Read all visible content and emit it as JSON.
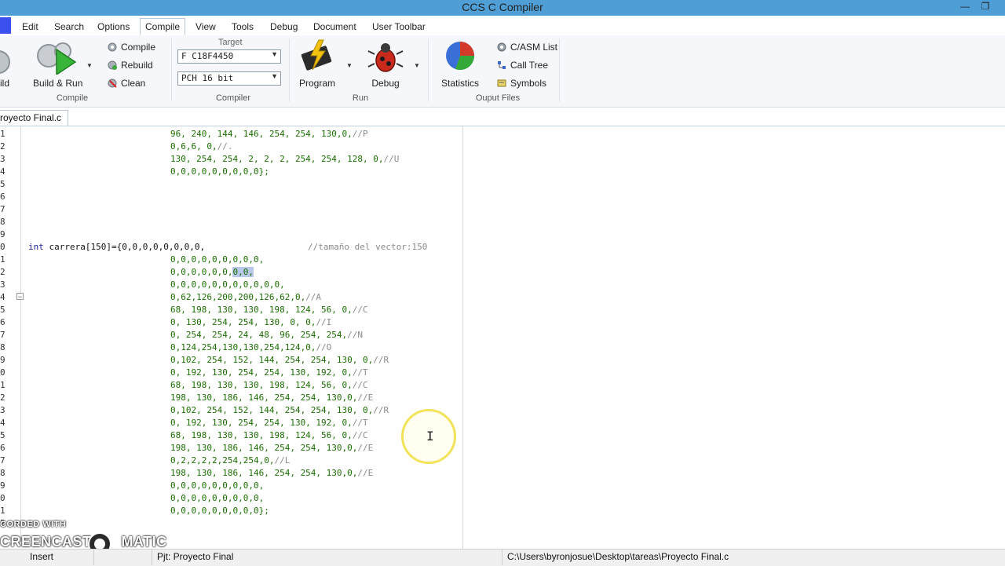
{
  "window": {
    "title": "CCS C Compiler"
  },
  "menu": {
    "items": [
      "Edit",
      "Search",
      "Options",
      "Compile",
      "View",
      "Tools",
      "Debug",
      "Document",
      "User Toolbar"
    ],
    "active": "Compile"
  },
  "ribbon": {
    "compile_group": {
      "label": "Compile",
      "build_partial": "ild",
      "build_run": "Build & Run",
      "compile": "Compile",
      "rebuild": "Rebuild",
      "clean": "Clean"
    },
    "compiler_group": {
      "label": "Compiler",
      "target_label": "Target",
      "target_value": "F C18F4450",
      "compiler_value": "PCH 16 bit"
    },
    "run_group": {
      "label": "Run",
      "program": "Program",
      "debug": "Debug"
    },
    "output_group": {
      "label": "Ouput Files",
      "statistics": "Statistics",
      "casm_list": "C/ASM List",
      "call_tree": "Call Tree",
      "symbols": "Symbols"
    }
  },
  "tabs": {
    "file": "royecto Final.c"
  },
  "editor": {
    "line_numbers": [
      "1",
      "2",
      "3",
      "4",
      "5",
      "6",
      "7",
      "8",
      "9",
      "0",
      "1",
      "2",
      "3",
      "4",
      "5",
      "6",
      "7",
      "8",
      "9",
      "0",
      "1",
      "2",
      "3",
      "4",
      "5",
      "6",
      "7",
      "8",
      "9",
      "0",
      "1",
      "2"
    ],
    "lines": [
      "96, 240, 144, 146, 254, 254, 130,0,",
      "0,6,6, 0,",
      "130, 254, 254, 2, 2, 2, 254, 254, 128, 0,",
      "0,0,0,0,0,0,0,0,0};",
      "int",
      " carrera[150]={0,0,0,0,0,0,0,0,",
      "0,0,0,0,0,0,0,0,0,",
      "0,0,0,0,0,0,",
      "0,0,",
      "0,0,0,0,0,0,0,0,0,0,0,",
      "0,62,126,200,200,126,62,0,",
      "68, 198, 130, 130, 198, 124, 56, 0,",
      "0, 130, 254, 254, 130, 0, 0,",
      "0, 254, 254, 24, 48, 96, 254, 254,",
      "0,124,254,130,130,254,124,0,",
      "0,102, 254, 152, 144, 254, 254, 130, 0,",
      "0, 192, 130, 254, 254, 130, 192, 0,",
      "68, 198, 130, 130, 198, 124, 56, 0,",
      "198, 130, 186, 146, 254, 254, 130,0,",
      "0,102, 254, 152, 144, 254, 254, 130, 0,",
      "0, 192, 130, 254, 254, 130, 192, 0,",
      "68, 198, 130, 130, 198, 124, 56, 0,",
      "198, 130, 186, 146, 254, 254, 130,0,",
      "0,2,2,2,2,254,254,0,",
      "198, 130, 186, 146, 254, 254, 130,0,",
      "0,0,0,0,0,0,0,0,0,",
      "0,0,0,0,0,0,0,0,0,",
      "0,0,0,0,0,0,0,0,0};"
    ],
    "comments": {
      "p": "//P",
      "dot": "//.",
      "u": "//U",
      "vec": "//tamaño del vector:150",
      "a": "//A",
      "c": "//C",
      "i": "//I",
      "n": "//N",
      "o": "//O",
      "r": "//R",
      "t": "//T",
      "e": "//E",
      "l": "//L"
    }
  },
  "watermark": {
    "line1": "CORDED WITH",
    "line2a": "CREENCAST",
    "line2b": "MATIC"
  },
  "statusbar": {
    "mode": "Insert",
    "project": "Pjt: Proyecto Final",
    "path": "C:\\Users\\byronjosue\\Desktop\\tareas\\Proyecto Final.c"
  },
  "colors": {
    "titlebar": "#4f9fd6",
    "code_number": "#1a6e00",
    "keyword": "#1c1c9c",
    "comment": "#8a8a8a",
    "selection": "#b7c8ea"
  }
}
